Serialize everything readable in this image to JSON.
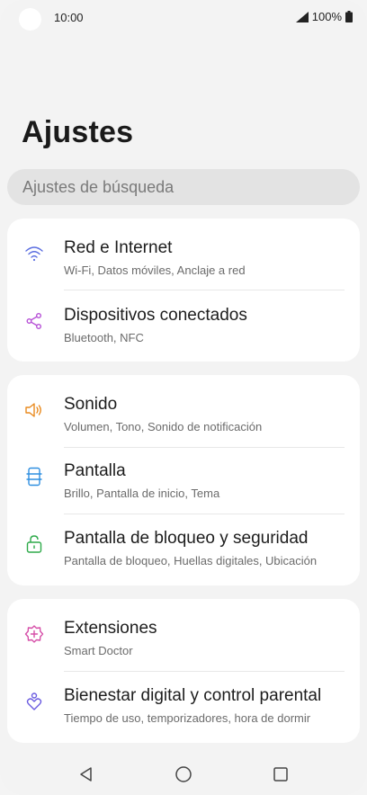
{
  "status_bar": {
    "time": "10:00",
    "battery": "100%"
  },
  "page": {
    "title": "Ajustes"
  },
  "search": {
    "placeholder": "Ajustes de búsqueda"
  },
  "groups": [
    {
      "items": [
        {
          "title": "Red e Internet",
          "subtitle": "Wi-Fi, Datos móviles, Anclaje a red",
          "icon": "wifi-icon",
          "color": "#5a6de0"
        },
        {
          "title": "Dispositivos conectados",
          "subtitle": "Bluetooth, NFC",
          "icon": "share-icon",
          "color": "#b64fd6"
        }
      ]
    },
    {
      "items": [
        {
          "title": "Sonido",
          "subtitle": "Volumen, Tono, Sonido de notificación",
          "icon": "speaker-icon",
          "color": "#e98a1e"
        },
        {
          "title": "Pantalla",
          "subtitle": "Brillo, Pantalla de inicio, Tema",
          "icon": "display-icon",
          "color": "#2f8fe0"
        },
        {
          "title": "Pantalla de bloqueo y seguridad",
          "subtitle": "Pantalla de bloqueo, Huellas digitales, Ubicación",
          "icon": "lock-icon",
          "color": "#2eaa4a"
        }
      ]
    },
    {
      "items": [
        {
          "title": "Extensiones",
          "subtitle": "Smart Doctor",
          "icon": "extensions-icon",
          "color": "#d64fa8"
        },
        {
          "title": "Bienestar digital y control parental",
          "subtitle": "Tiempo de uso, temporizadores, hora de dormir",
          "icon": "wellbeing-icon",
          "color": "#6a5be0"
        }
      ]
    }
  ],
  "nav": {
    "icons": [
      "back-icon",
      "home-icon",
      "recents-icon"
    ]
  }
}
